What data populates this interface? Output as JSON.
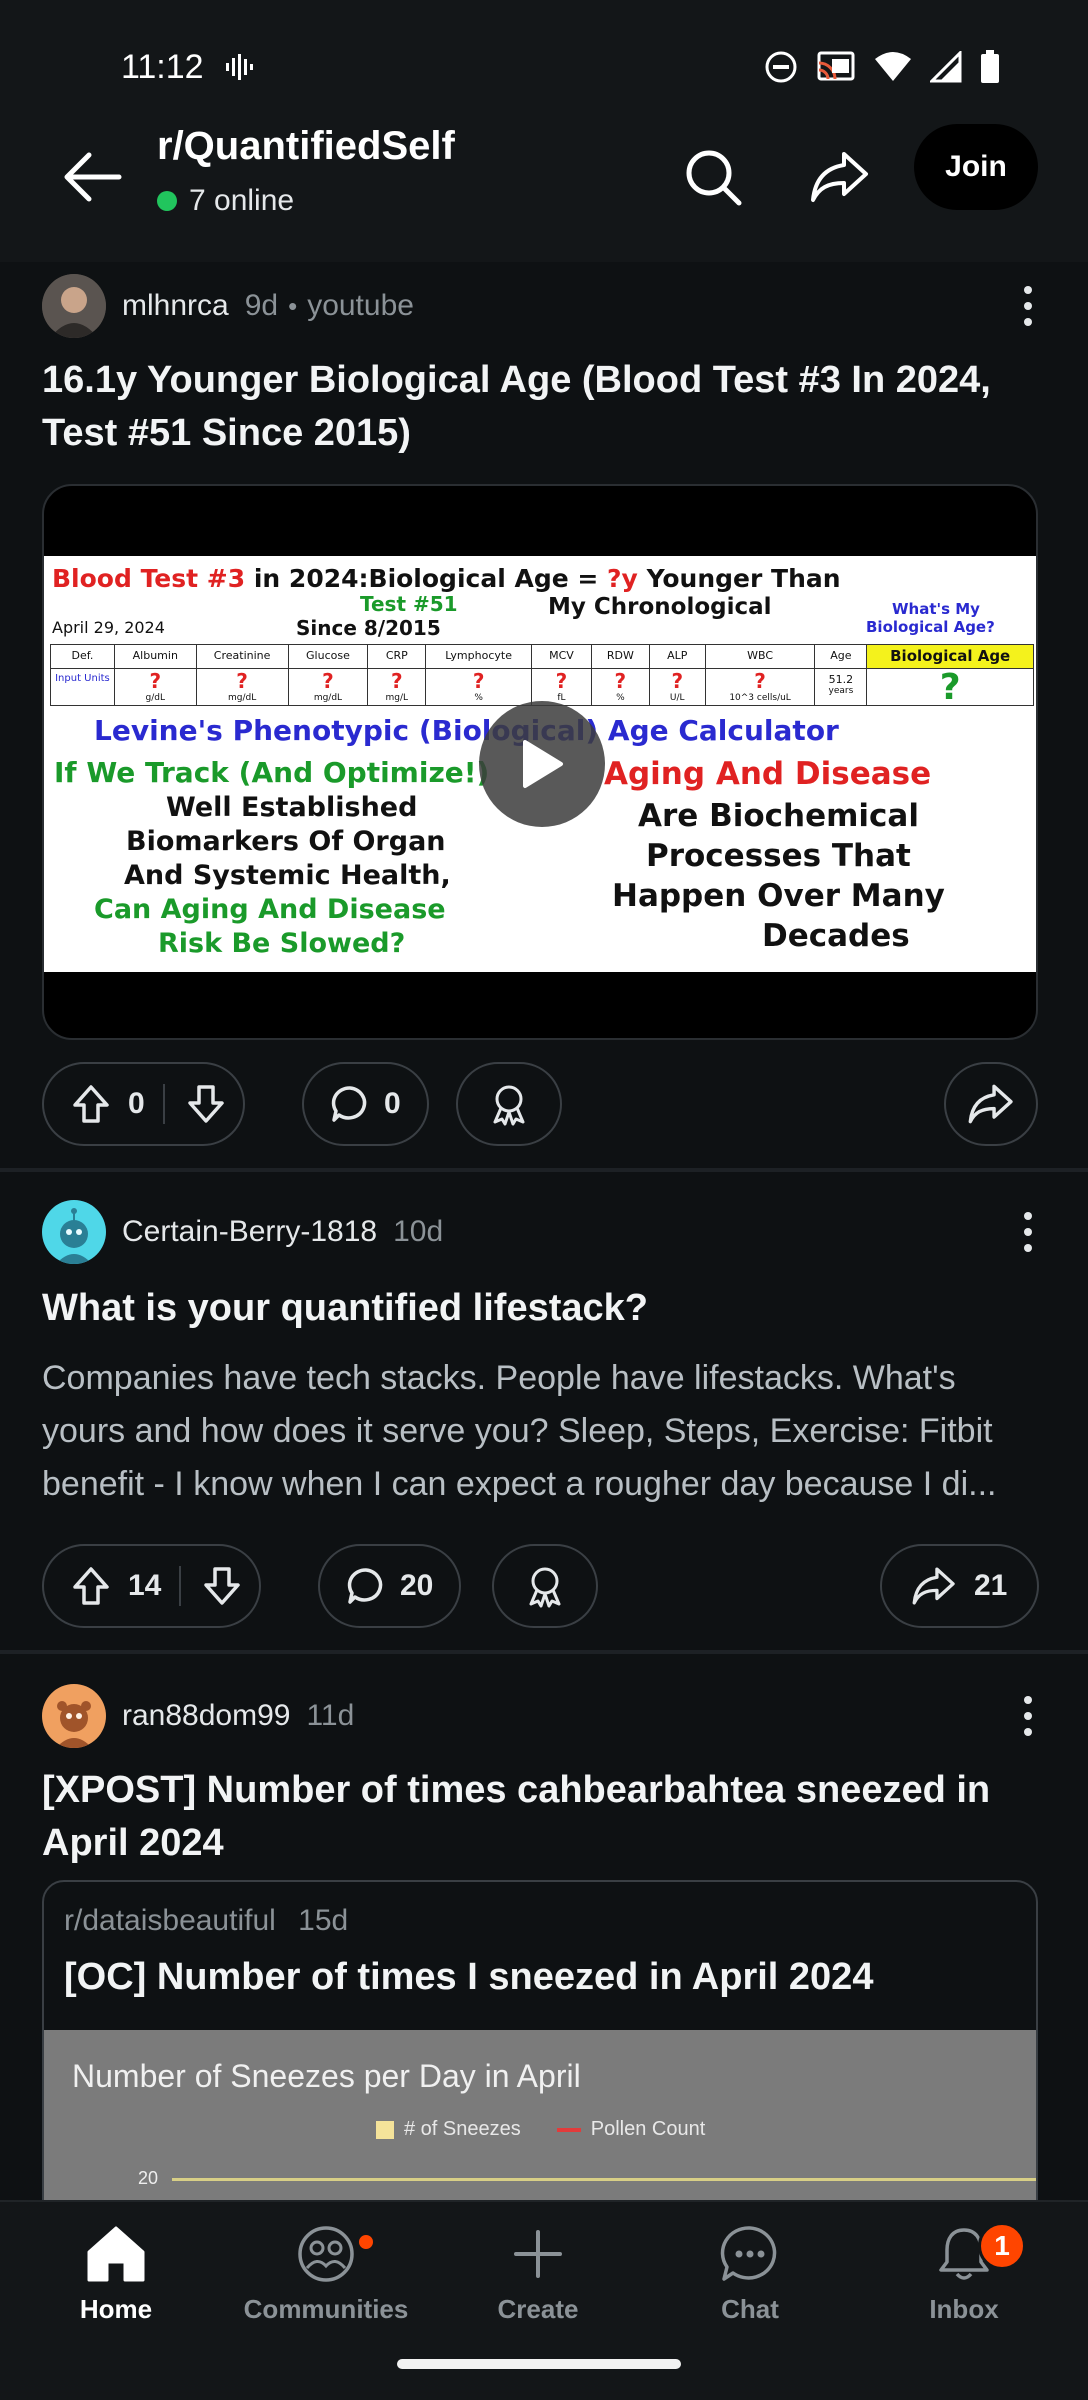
{
  "status_bar": {
    "time": "11:12"
  },
  "header": {
    "subreddit": "r/QuantifiedSelf",
    "online": "7 online",
    "join_label": "Join"
  },
  "posts": [
    {
      "user": "mlhnrca",
      "age": "9d",
      "source": "youtube",
      "title": "16.1y Younger Biological Age (Blood Test #3 In 2024, Test #51 Since 2015)",
      "thumbnail": {
        "line1_red": "Blood Test #3",
        "line1_rest": "in 2024:Biological Age = ",
        "line1_q": "?y",
        "line1_end": " Younger Than",
        "test": "Test #51",
        "chrono": "My Chronological",
        "date": "April 29, 2024",
        "since": "Since 8/2015",
        "whats": "What's My",
        "bio_q": "Biological Age?",
        "columns": [
          "Def.",
          "Albumin",
          "Creatinine",
          "Glucose",
          "CRP",
          "Lymphocyte",
          "MCV",
          "RDW",
          "ALP",
          "WBC",
          "Age",
          "Biological Age"
        ],
        "row_label": "Input Units",
        "units": [
          "g/dL",
          "mg/dL",
          "mg/dL",
          "mg/L",
          "%",
          "fL",
          "%",
          "U/L",
          "10^3 cells/uL",
          "years"
        ],
        "age_val": "51.2",
        "big_q": "?",
        "calc": "Levine's Phenotypic (Biological) Age Calculator",
        "left1": "If We Track (And Optimize!)",
        "left2": "Well Established",
        "left3": "Biomarkers Of Organ",
        "left4": "And Systemic Health,",
        "left5": "Can Aging And Disease",
        "left6": "Risk Be Slowed?",
        "right1": "Aging And Disease",
        "right2": "Are Biochemical",
        "right3": "Processes That",
        "right4": "Happen Over Many",
        "right5": "Decades"
      },
      "upvotes": "0",
      "comments": "0"
    },
    {
      "user": "Certain-Berry-1818",
      "age": "10d",
      "title": "What is your quantified lifestack?",
      "body": "Companies have tech stacks. People have lifestacks. What's yours and how does it serve you? Sleep, Steps, Exercise: Fitbit benefit - I know when I can expect a rougher day because I di...",
      "upvotes": "14",
      "comments": "20",
      "shares": "21"
    },
    {
      "user": "ran88dom99",
      "age": "11d",
      "title": "[XPOST] Number of times cahbearbahtea sneezed in April 2024",
      "crosspost": {
        "subreddit": "r/dataisbeautiful",
        "age": "15d",
        "title": "[OC] Number of times I sneezed in April 2024",
        "chart_title": "Number of Sneezes per Day in April",
        "legend_a": "# of Sneezes",
        "legend_b": "Pollen Count",
        "tick": "20"
      }
    }
  ],
  "nav": {
    "items": [
      {
        "label": "Home"
      },
      {
        "label": "Communities"
      },
      {
        "label": "Create"
      },
      {
        "label": "Chat"
      },
      {
        "label": "Inbox"
      }
    ],
    "inbox_badge": "1"
  }
}
